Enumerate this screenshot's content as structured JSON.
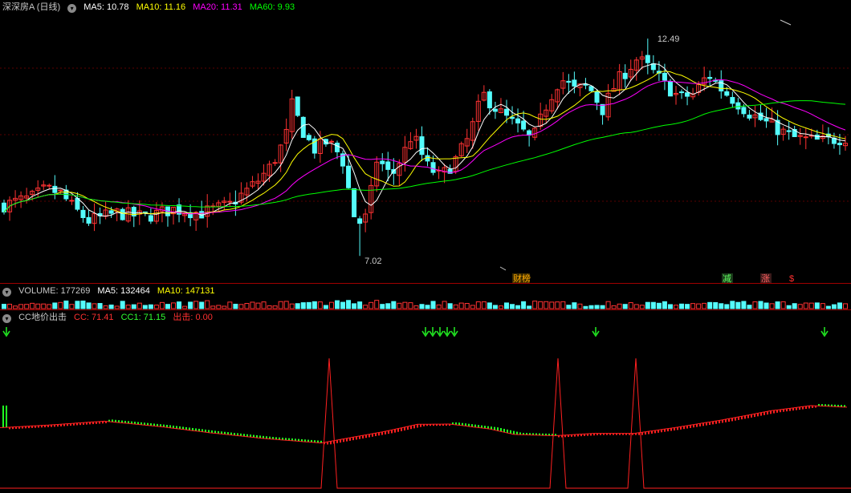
{
  "price_panel": {
    "title": "深深房A (日线)",
    "ma5_label": "MA5: 10.78",
    "ma10_label": "MA10: 11.16",
    "ma20_label": "MA20: 11.31",
    "ma60_label": "MA60: 9.93",
    "high_label": "12.49",
    "low_label": "7.02",
    "event_caibang": "财榜",
    "event_jian": "减",
    "event_zhang": "涨",
    "event_s": "$"
  },
  "volume_panel": {
    "vol_label": "VOLUME: 177269",
    "ma5_label": "MA5: 132464",
    "ma10_label": "MA10: 147131"
  },
  "cc_panel": {
    "title": "CC地价出击",
    "cc_label": "CC: 71.41",
    "cc1_label": "CC1: 71.15",
    "signal_label": "出击: 0.00"
  },
  "colors": {
    "up": "#ff3232",
    "down": "#54fcfc",
    "ma5": "#ffffff",
    "ma10": "#ffff00",
    "ma20": "#ff00ff",
    "ma60": "#00ff00",
    "cc_up": "#ff2020",
    "cc_down": "#20ff20",
    "signal": "#ff2020"
  },
  "icons": [
    "collapse-toggle-icon",
    "arrow-down-icon"
  ],
  "chart_data": [
    {
      "type": "candlestick",
      "name": "price",
      "ylim": [
        6.5,
        13.3
      ],
      "x_count": 150,
      "anchors": [
        [
          0,
          8.3
        ],
        [
          8,
          8.5
        ],
        [
          12,
          8.7
        ],
        [
          16,
          8.6
        ],
        [
          20,
          8.2
        ],
        [
          24,
          7.9
        ],
        [
          32,
          8.1
        ],
        [
          40,
          8.0
        ],
        [
          48,
          8.2
        ],
        [
          56,
          8.1
        ],
        [
          64,
          8.3
        ],
        [
          72,
          8.9
        ],
        [
          76,
          9.3
        ],
        [
          80,
          10.0
        ],
        [
          82,
          10.9
        ],
        [
          84,
          10.3
        ],
        [
          88,
          9.7
        ],
        [
          92,
          9.9
        ],
        [
          96,
          9.5
        ],
        [
          100,
          7.8
        ],
        [
          103,
          8.0
        ],
        [
          106,
          9.5
        ],
        [
          110,
          9.0
        ],
        [
          114,
          9.7
        ],
        [
          116,
          10.1
        ],
        [
          120,
          9.3
        ],
        [
          124,
          9.0
        ],
        [
          128,
          9.4
        ],
        [
          132,
          10.0
        ],
        [
          136,
          11.1
        ],
        [
          140,
          10.7
        ],
        [
          144,
          10.4
        ],
        [
          148,
          10.1
        ],
        [
          150,
          9.9
        ],
        [
          154,
          10.8
        ],
        [
          158,
          11.5
        ],
        [
          162,
          11.2
        ],
        [
          166,
          11.3
        ],
        [
          170,
          10.7
        ],
        [
          174,
          11.4
        ],
        [
          180,
          12.0
        ],
        [
          185,
          11.6
        ],
        [
          188,
          11.3
        ],
        [
          192,
          11.0
        ],
        [
          196,
          11.1
        ],
        [
          200,
          11.6
        ],
        [
          204,
          11.2
        ],
        [
          208,
          10.9
        ],
        [
          212,
          10.6
        ],
        [
          216,
          10.4
        ],
        [
          220,
          10.2
        ],
        [
          224,
          10.0
        ],
        [
          232,
          9.9
        ],
        [
          239,
          10.0
        ]
      ],
      "high_point": {
        "value": 12.49
      },
      "low_point": {
        "value": 7.02
      }
    },
    {
      "type": "line",
      "name": "moving-averages",
      "series": [
        {
          "name": "MA5",
          "period": 5
        },
        {
          "name": "MA10",
          "period": 10
        },
        {
          "name": "MA20",
          "period": 20
        },
        {
          "name": "MA60",
          "period": 60
        }
      ]
    },
    {
      "type": "bar",
      "name": "volume",
      "ylim": [
        0,
        400000
      ],
      "last_value": 177269
    },
    {
      "type": "bar",
      "name": "cc",
      "ylim": [
        50,
        100
      ],
      "x_count": 1055,
      "cc_anchors": [
        [
          0,
          73.3
        ],
        [
          60,
          74.3
        ],
        [
          130,
          75.8
        ],
        [
          200,
          73.7
        ],
        [
          260,
          71.4
        ],
        [
          330,
          69.1
        ],
        [
          400,
          67.4
        ],
        [
          430,
          69.1
        ],
        [
          480,
          71.9
        ],
        [
          520,
          74.6
        ],
        [
          560,
          74.7
        ],
        [
          610,
          72.8
        ],
        [
          640,
          70.7
        ],
        [
          690,
          70.2
        ],
        [
          740,
          71.1
        ],
        [
          790,
          71.1
        ],
        [
          840,
          73.3
        ],
        [
          900,
          76.3
        ],
        [
          960,
          79.8
        ],
        [
          1010,
          81.8
        ],
        [
          1055,
          81.2
        ]
      ],
      "signal_spikes": [
        {
          "x": 410,
          "value": 100
        },
        {
          "x": 695,
          "value": 100
        },
        {
          "x": 792,
          "value": 100
        }
      ],
      "arrows": [
        8,
        530,
        539,
        548,
        557,
        566,
        742,
        1027
      ]
    }
  ]
}
